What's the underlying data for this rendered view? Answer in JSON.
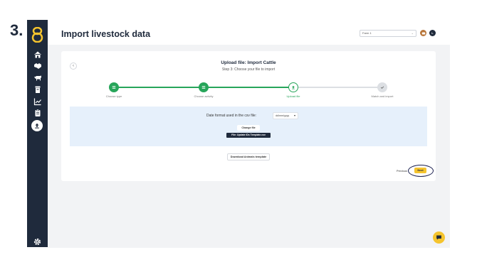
{
  "step_number": "3.",
  "header": {
    "title": "Import livestock data",
    "farm_select": "Farm 1",
    "user_initial": "L"
  },
  "card": {
    "title": "Upload file: Import Cattle",
    "subtitle": "Step 3: Choose your file to import"
  },
  "steps": [
    {
      "label": "Choose type",
      "state": "done"
    },
    {
      "label": "Choose activity",
      "state": "done"
    },
    {
      "label": "Upload file",
      "state": "active"
    },
    {
      "label": "Match and import",
      "state": "pending"
    }
  ],
  "upload": {
    "date_format_label": "Date format used in the csv file:",
    "date_format_value": "dd/mm/yyyy",
    "change_file_label": "Change file",
    "file_name": "File: Update IDs Template.csv"
  },
  "actions": {
    "download_label": "Download Animals template",
    "previous_label": "Previous",
    "next_label": "Next"
  },
  "colors": {
    "sidebar": "#1f2a3c",
    "accent_green": "#27a55a",
    "accent_yellow": "#f5c42e",
    "upload_zone": "#e6f0fb"
  },
  "icons": [
    "home-icon",
    "handshake-icon",
    "cattle-icon",
    "bin-icon",
    "chart-icon",
    "clipboard-icon",
    "upload-icon",
    "gear-icon",
    "chat-icon"
  ]
}
